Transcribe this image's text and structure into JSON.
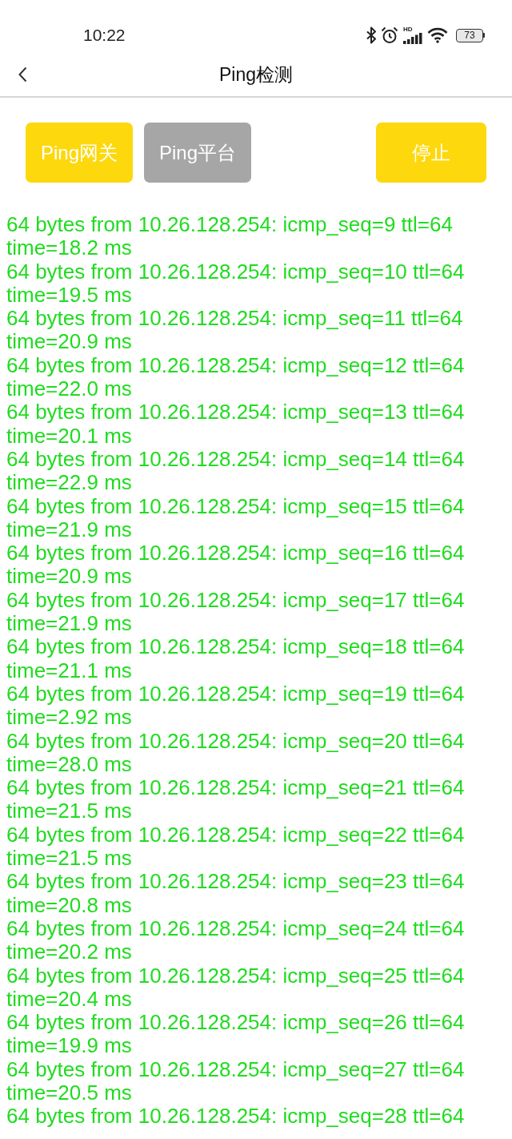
{
  "status_bar": {
    "time": "10:22",
    "network_label": "HD",
    "battery": "73"
  },
  "header": {
    "title": "Ping检测"
  },
  "buttons": [
    {
      "label": "Ping网关",
      "disabled": false
    },
    {
      "label": "Ping平台",
      "disabled": true
    }
  ],
  "stop_button": {
    "label": "停止",
    "disabled": false
  },
  "log": [
    "64 bytes from 10.26.128.254: icmp_seq=9 ttl=64 time=18.2 ms",
    "64 bytes from 10.26.128.254: icmp_seq=10 ttl=64 time=19.5 ms",
    "64 bytes from 10.26.128.254: icmp_seq=11 ttl=64 time=20.9 ms",
    "64 bytes from 10.26.128.254: icmp_seq=12 ttl=64 time=22.0 ms",
    "64 bytes from 10.26.128.254: icmp_seq=13 ttl=64 time=20.1 ms",
    "64 bytes from 10.26.128.254: icmp_seq=14 ttl=64 time=22.9 ms",
    "64 bytes from 10.26.128.254: icmp_seq=15 ttl=64 time=21.9 ms",
    "64 bytes from 10.26.128.254: icmp_seq=16 ttl=64 time=20.9 ms",
    "64 bytes from 10.26.128.254: icmp_seq=17 ttl=64 time=21.9 ms",
    "64 bytes from 10.26.128.254: icmp_seq=18 ttl=64 time=21.1 ms",
    "64 bytes from 10.26.128.254: icmp_seq=19 ttl=64 time=2.92 ms",
    "64 bytes from 10.26.128.254: icmp_seq=20 ttl=64 time=28.0 ms",
    "64 bytes from 10.26.128.254: icmp_seq=21 ttl=64 time=21.5 ms",
    "64 bytes from 10.26.128.254: icmp_seq=22 ttl=64 time=21.5 ms",
    "64 bytes from 10.26.128.254: icmp_seq=23 ttl=64 time=20.8 ms",
    "64 bytes from 10.26.128.254: icmp_seq=24 ttl=64 time=20.2 ms",
    "64 bytes from 10.26.128.254: icmp_seq=25 ttl=64 time=20.4 ms",
    "64 bytes from 10.26.128.254: icmp_seq=26 ttl=64 time=19.9 ms",
    "64 bytes from 10.26.128.254: icmp_seq=27 ttl=64 time=20.5 ms",
    "64 bytes from 10.26.128.254: icmp_seq=28 ttl=64"
  ]
}
